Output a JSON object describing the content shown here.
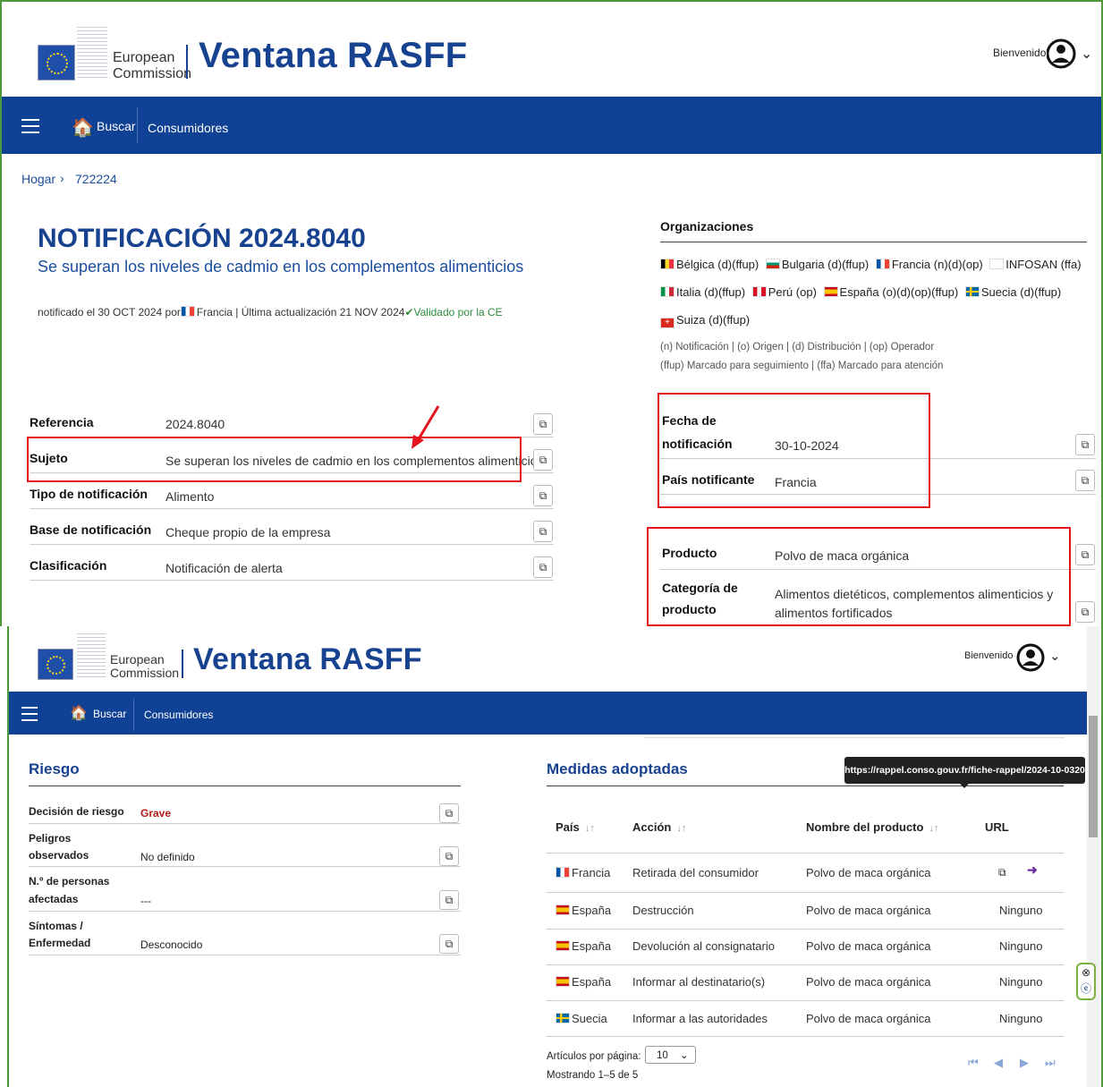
{
  "screen1": {
    "brand": {
      "line1": "European",
      "line2": "Commission",
      "title": "Ventana RASFF"
    },
    "user": {
      "greeting": "Bienvenido"
    },
    "nav": {
      "search": "Buscar",
      "consumers": "Consumidores"
    },
    "breadcrumb": {
      "home": "Hogar",
      "separator": "›",
      "current": "722224"
    },
    "notification": {
      "title": "NOTIFICACIÓN 2024.8040",
      "subtitle": "Se superan los niveles de cadmio en los complementos alimenticios",
      "meta_prefix": "notificado el 30 OCT 2024 por",
      "meta_country": "Francia | Última actualización 21 NOV 2024",
      "validated": "Validado por la CE"
    },
    "details": [
      {
        "label": "Referencia",
        "value": "2024.8040"
      },
      {
        "label": "Sujeto",
        "value": "Se superan los niveles de cadmio en los complementos alimenticios"
      },
      {
        "label": "Tipo de notificación",
        "value": "Alimento"
      },
      {
        "label": "Base de notificación",
        "value": "Cheque propio de la empresa"
      },
      {
        "label": "Clasificación",
        "value": "Notificación de alerta"
      }
    ],
    "organizations": {
      "title": "Organizaciones",
      "line1": [
        "Bélgica (d)(ffup)",
        "Bulgaria (d)(ffup)",
        "Francia (n)(d)(op)",
        "INFOSAN (ffa)"
      ],
      "line2": [
        "Italia (d)(ffup)",
        "Perú (op)",
        "España (o)(d)(op)(ffup)",
        "Suecia (d)(ffup)"
      ],
      "line3": [
        "Suiza (d)(ffup)"
      ],
      "legend1": "(n) Notificación | (o) Origen | (d) Distribución | (op) Operador",
      "legend2": "(ffup) Marcado para seguimiento | (ffa) Marcado para atención"
    },
    "notif_date": {
      "label1": "Fecha de",
      "label2": "notificación",
      "value": "30-10-2024"
    },
    "notif_country": {
      "label": "País notificante",
      "value": "Francia"
    },
    "product": {
      "label": "Producto",
      "value": "Polvo de maca orgánica"
    },
    "category": {
      "label1": "Categoría de",
      "label2": "producto",
      "value1": "Alimentos dietéticos, complementos alimenticios y",
      "value2": "alimentos fortificados"
    }
  },
  "screen2": {
    "brand": {
      "line1": "European",
      "line2": "Commission",
      "title": "Ventana RASFF"
    },
    "user": {
      "greeting": "Bienvenido"
    },
    "nav": {
      "search": "Buscar",
      "consumers": "Consumidores"
    },
    "risk": {
      "title": "Riesgo",
      "decision_label": "Decisión de riesgo",
      "decision_value": "Grave",
      "hazards_label1": "Peligros",
      "hazards_label2": "observados",
      "hazards_value": "No definido",
      "people_label1": "N.º de personas",
      "people_label2": "afectadas",
      "people_value": "---",
      "symptoms_label1": "Síntomas /",
      "symptoms_label2": "Enfermedad",
      "symptoms_value": "Desconocido"
    },
    "measures": {
      "title": "Medidas adoptadas",
      "tooltip": "https://rappel.conso.gouv.fr/fiche-rappel/2024-10-0320",
      "headers": {
        "country": "País",
        "action": "Acción",
        "product": "Nombre del producto",
        "url": "URL"
      },
      "rows": [
        {
          "country": "Francia",
          "action": "Retirada del consumidor",
          "product": "Polvo de maca orgánica",
          "url": ""
        },
        {
          "country": "España",
          "action": "Destrucción",
          "product": "Polvo de maca orgánica",
          "url": "Ninguno"
        },
        {
          "country": "España",
          "action": "Devolución al consignatario",
          "product": "Polvo de maca orgánica",
          "url": "Ninguno"
        },
        {
          "country": "España",
          "action": "Informar al destinatario(s)",
          "product": "Polvo de maca orgánica",
          "url": "Ninguno"
        },
        {
          "country": "Suecia",
          "action": "Informar a las autoridades",
          "product": "Polvo de maca orgánica",
          "url": "Ninguno"
        }
      ],
      "per_page_label": "Artículos por página:",
      "per_page_value": "10",
      "showing": "Mostrando 1–5 de 5"
    }
  }
}
